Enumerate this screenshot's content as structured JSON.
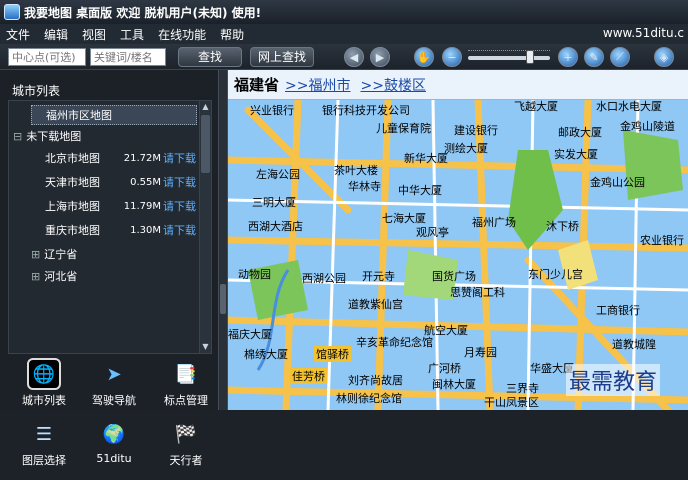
{
  "titlebar": {
    "title": "我要地图 桌面版 欢迎 脱机用户(未知) 使用!"
  },
  "menu": {
    "items": [
      "文件",
      "编辑",
      "视图",
      "工具",
      "在线功能",
      "帮助"
    ],
    "url": "www.51ditu.c"
  },
  "toolbar": {
    "center_placeholder": "中心点(可选)",
    "keyword_placeholder": "关键词/楼名",
    "search_label": "查找",
    "web_search_label": "网上查找"
  },
  "left": {
    "panel_title": "城市列表",
    "tree": {
      "fuzhou_district": "福州市区地图",
      "undownloaded": "未下载地图",
      "cities": [
        {
          "name": "北京市地图",
          "size": "21.72M",
          "action": "请下载"
        },
        {
          "name": "天津市地图",
          "size": "0.55M",
          "action": "请下载"
        },
        {
          "name": "上海市地图",
          "size": "11.79M",
          "action": "请下载"
        },
        {
          "name": "重庆市地图",
          "size": "1.30M",
          "action": "请下载"
        }
      ],
      "liaoning": "辽宁省",
      "hebei": "河北省"
    },
    "icons": [
      "城市列表",
      "驾驶导航",
      "标点管理",
      "图层选择",
      "51ditu",
      "天行者"
    ]
  },
  "map": {
    "breadcrumb": {
      "province": "福建省",
      "city": ">>福州市",
      "district": ">>鼓楼区"
    },
    "labels": [
      {
        "t": "兴业银行"
      },
      {
        "t": "银行科技开发公司"
      },
      {
        "t": "飞越大厦"
      },
      {
        "t": "水口水电大厦"
      },
      {
        "t": "儿童保育院"
      },
      {
        "t": "建设银行"
      },
      {
        "t": "邮政大厦"
      },
      {
        "t": "金鸡山陵道"
      },
      {
        "t": "测绘大厦"
      },
      {
        "t": "实发大厦"
      },
      {
        "t": "左海公园"
      },
      {
        "t": "茶叶大楼"
      },
      {
        "t": "新华大厦"
      },
      {
        "t": "华林寺"
      },
      {
        "t": "中华大厦"
      },
      {
        "t": "金鸡山公园"
      },
      {
        "t": "三明大厦"
      },
      {
        "t": "西湖大酒店"
      },
      {
        "t": "七海大厦"
      },
      {
        "t": "观风亭"
      },
      {
        "t": "福州广场"
      },
      {
        "t": "沐下桥"
      },
      {
        "t": "农业银行"
      },
      {
        "t": "动物园"
      },
      {
        "t": "西湖公园"
      },
      {
        "t": "开元寺"
      },
      {
        "t": "国货广场"
      },
      {
        "t": "东门少儿宫"
      },
      {
        "t": "思赞阁工科"
      },
      {
        "t": "道教紫仙宫"
      },
      {
        "t": "工商银行"
      },
      {
        "t": "福庆大厦"
      },
      {
        "t": "辛亥革命纪念馆"
      },
      {
        "t": "航空大厦"
      },
      {
        "t": "棉绣大厦"
      },
      {
        "t": "馆驿桥"
      },
      {
        "t": "月寿园"
      },
      {
        "t": "佳芳桥"
      },
      {
        "t": "刘齐尚故居"
      },
      {
        "t": "广河桥"
      },
      {
        "t": "闽林大厦"
      },
      {
        "t": "三界寺"
      },
      {
        "t": "林则徐纪念馆"
      },
      {
        "t": "干山凤景区"
      },
      {
        "t": "道教城隍"
      },
      {
        "t": "华盛大厦"
      }
    ],
    "watermark": "最需教育"
  }
}
